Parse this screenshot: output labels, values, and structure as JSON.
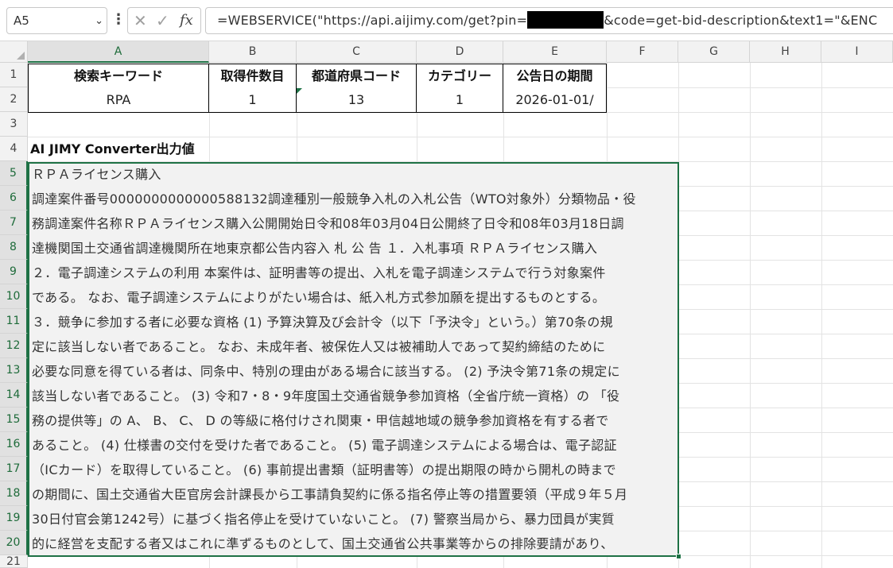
{
  "formula_bar": {
    "name_box": "A5",
    "formula_prefix": "=WEBSERVICE(\"https://api.aijimy.com/get?pin=",
    "formula_suffix": "&code=get-bid-description&text1=\"&ENC"
  },
  "columns": [
    "A",
    "B",
    "C",
    "D",
    "E",
    "F",
    "G",
    "H",
    "I"
  ],
  "rows": [
    "1",
    "2",
    "3",
    "4",
    "5",
    "6",
    "7",
    "8",
    "9",
    "10",
    "11",
    "12",
    "13",
    "14",
    "15",
    "16",
    "17",
    "18",
    "19",
    "20",
    "21"
  ],
  "table": {
    "headers": [
      "検索キーワード",
      "取得件数目",
      "都道府県コード",
      "カテゴリー",
      "公告日の期間"
    ],
    "values": [
      "RPA",
      "1",
      "13",
      "1",
      "2026-01-01/"
    ]
  },
  "output_label": "AI JIMY Converter出力値",
  "output_lines": [
    "ＲＰＡライセンス購入",
    "調達案件番号0000000000000588132調達種別一般競争入札の入札公告（WTO対象外）分類物品・役",
    "務調達案件名称ＲＰＡライセンス購入公開開始日令和08年03月04日公開終了日令和08年03月18日調",
    "達機関国土交通省調達機関所在地東京都公告内容入 札 公 告 １．入札事項 ＲＰＡライセンス購入",
    " ２．電子調達システムの利用 本案件は、証明書等の提出、入札を電子調達システムで行う対象案件",
    "である。 なお、電子調達システムによりがたい場合は、紙入札方式参加願を提出するものとする。",
    " ３．競争に参加する者に必要な資格 (1) 予算決算及び会計令（以下「予決令」という。）第70条の規",
    "定に該当しない者であること。 なお、未成年者、被保佐人又は被補助人であって契約締結のために",
    "必要な同意を得ている者は、同条中、特別の理由がある場合に該当する。 (2) 予決令第71条の規定に",
    "該当しない者であること。 (3) 令和7・8・9年度国土交通省競争参加資格（全省庁統一資格）の 「役",
    "務の提供等」の A、 B、 C、 D の等級に格付けされ関東・甲信越地域の競争参加資格を有する者で",
    "あること。 (4) 仕様書の交付を受けた者であること。 (5) 電子調達システムによる場合は、電子認証",
    "（ICカード）を取得していること。 (6) 事前提出書類（証明書等）の提出期限の時から開札の時まで",
    "の期間に、国土交通省大臣官房会計課長から工事請負契約に係る指名停止等の措置要領（平成９年５月",
    "30日付官会第1242号）に基づく指名停止を受けていないこと。 (7) 警察当局から、暴力団員が実質",
    "的に経営を支配する者又はこれに準ずるものとして、国土交通省公共事業等からの排除要請があり、"
  ]
}
